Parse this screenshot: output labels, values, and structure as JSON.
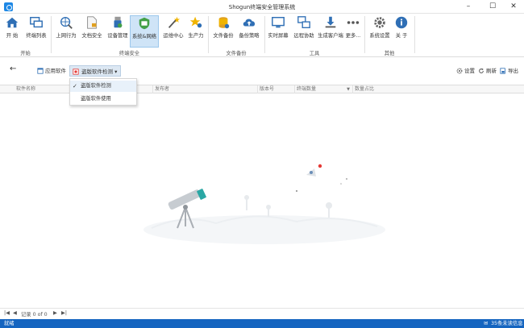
{
  "window": {
    "title": "Shogun终端安全管理系统",
    "minimize": "–",
    "maximize": "☐",
    "close": "✕"
  },
  "ribbon": {
    "buttons": [
      {
        "label": "开 始",
        "icon": "home-icon"
      },
      {
        "label": "终端列表",
        "icon": "monitor-list-icon"
      },
      {
        "label": "上网行为",
        "icon": "globe-search-icon"
      },
      {
        "label": "文档安全",
        "icon": "document-lock-icon"
      },
      {
        "label": "设备管理",
        "icon": "usb-device-icon"
      },
      {
        "label": "系统&网络",
        "icon": "shield-network-icon"
      },
      {
        "label": "运维中心",
        "icon": "magic-wand-icon"
      },
      {
        "label": "生产力",
        "icon": "star-person-icon"
      },
      {
        "label": "文件备份",
        "icon": "database-backup-icon"
      },
      {
        "label": "备份策略",
        "icon": "cloud-upload-icon"
      },
      {
        "label": "实时屏幕",
        "icon": "screen-icon"
      },
      {
        "label": "远程协助",
        "icon": "remote-assist-icon"
      },
      {
        "label": "生成客户端",
        "icon": "download-icon"
      },
      {
        "label": "更多...",
        "icon": "more-icon"
      },
      {
        "label": "系统设置",
        "icon": "gear-icon"
      },
      {
        "label": "关 于",
        "icon": "info-icon"
      }
    ],
    "groups": [
      "开始",
      "终端安全",
      "文件备份",
      "工具",
      "其他"
    ]
  },
  "toolbar": {
    "back": "←",
    "apps_label": "应用软件",
    "piracy_label": "盗版软件检测",
    "settings_label": "设置",
    "refresh_label": "刷新",
    "export_label": "导出"
  },
  "dropdown": {
    "items": [
      "盗版软件检测",
      "盗版软件使用"
    ],
    "selected": "盗版软件检测",
    "check": "✓"
  },
  "table": {
    "columns": [
      "软件名称",
      "版本号",
      "发布者",
      "版本号",
      "终端数量",
      "数量占比"
    ]
  },
  "pager": {
    "first": "|◀",
    "prev": "◀",
    "text": "记录 0 of 0",
    "next": "▶",
    "last": "▶|"
  },
  "status": {
    "left": "就绪",
    "right": "35条未读信息"
  },
  "colors": {
    "accent": "#1565c0",
    "active_ribbon": "#cfe4f7",
    "marker": "#e53935"
  }
}
